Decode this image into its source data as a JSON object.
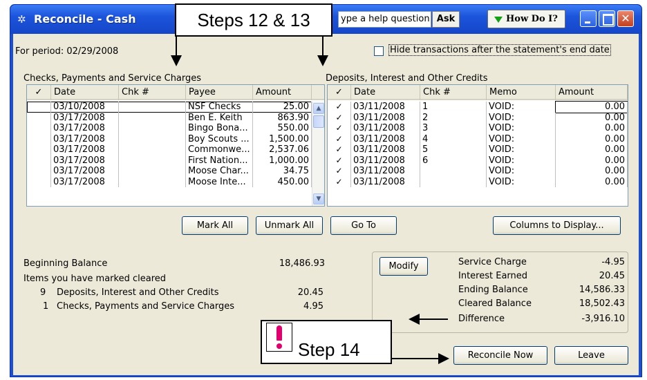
{
  "window": {
    "title": "Reconcile - Cash",
    "help_placeholder": "ype a help question",
    "ask_label": "Ask",
    "howdo_label": "How Do I?"
  },
  "period_label": "For period: 02/29/2008",
  "hide_label": "Hide transactions after the statement's end date",
  "checks": {
    "section_label": "Checks, Payments and Service Charges",
    "headers": [
      "✓",
      "Date",
      "Chk #",
      "Payee",
      "Amount"
    ],
    "rows": [
      {
        "check": "",
        "date": "03/10/2008",
        "chk": "",
        "payee": "NSF Checks",
        "amount": "25.00"
      },
      {
        "check": "",
        "date": "03/17/2008",
        "chk": "",
        "payee": "Ben E. Keith",
        "amount": "863.90"
      },
      {
        "check": "",
        "date": "03/17/2008",
        "chk": "",
        "payee": "Bingo Bona...",
        "amount": "550.00"
      },
      {
        "check": "",
        "date": "03/17/2008",
        "chk": "",
        "payee": "Boy Scouts ...",
        "amount": "1,500.00"
      },
      {
        "check": "",
        "date": "03/17/2008",
        "chk": "",
        "payee": "Commonwe...",
        "amount": "2,537.06"
      },
      {
        "check": "",
        "date": "03/17/2008",
        "chk": "",
        "payee": "First Nation...",
        "amount": "1,000.00"
      },
      {
        "check": "",
        "date": "03/17/2008",
        "chk": "",
        "payee": "Moose Char...",
        "amount": "34.75"
      },
      {
        "check": "",
        "date": "03/17/2008",
        "chk": "",
        "payee": "Moose Inte...",
        "amount": "450.00"
      }
    ]
  },
  "deposits": {
    "section_label": "Deposits, Interest and Other Credits",
    "headers": [
      "✓",
      "Date",
      "Chk #",
      "Memo",
      "Amount"
    ],
    "rows": [
      {
        "check": "✓",
        "date": "03/11/2008",
        "chk": "1",
        "memo": "VOID:",
        "amount": "0.00"
      },
      {
        "check": "✓",
        "date": "03/11/2008",
        "chk": "2",
        "memo": "VOID:",
        "amount": "0.00"
      },
      {
        "check": "✓",
        "date": "03/11/2008",
        "chk": "3",
        "memo": "VOID:",
        "amount": "0.00"
      },
      {
        "check": "✓",
        "date": "03/11/2008",
        "chk": "4",
        "memo": "VOID:",
        "amount": "0.00"
      },
      {
        "check": "✓",
        "date": "03/11/2008",
        "chk": "5",
        "memo": "VOID:",
        "amount": "0.00"
      },
      {
        "check": "✓",
        "date": "03/11/2008",
        "chk": "6",
        "memo": "VOID:",
        "amount": "0.00"
      },
      {
        "check": "✓",
        "date": "03/11/2008",
        "chk": "",
        "memo": "VOID:",
        "amount": "0.00"
      },
      {
        "check": "✓",
        "date": "03/11/2008",
        "chk": "",
        "memo": "VOID:",
        "amount": "0.00"
      }
    ]
  },
  "buttons": {
    "mark_all": "Mark All",
    "unmark_all": "Unmark All",
    "go_to": "Go To",
    "columns_to_display": "Columns to Display...",
    "modify": "Modify",
    "reconcile_now": "Reconcile Now",
    "leave": "Leave"
  },
  "summary": {
    "beginning_balance_label": "Beginning Balance",
    "beginning_balance_value": "18,486.93",
    "items_cleared_label": "Items you have marked cleared",
    "deposits_count": "9",
    "deposits_label": "Deposits, Interest and Other Credits",
    "deposits_value": "20.45",
    "checks_count": "1",
    "checks_label": "Checks, Payments and Service Charges",
    "checks_value": "4.95"
  },
  "balances": [
    {
      "label": "Service Charge",
      "value": "-4.95"
    },
    {
      "label": "Interest Earned",
      "value": "20.45"
    },
    {
      "label": "Ending Balance",
      "value": "14,586.33"
    },
    {
      "label": "Cleared Balance",
      "value": "18,502.43"
    },
    {
      "label": "Difference",
      "value": "-3,916.10"
    }
  ],
  "callouts": {
    "steps_12_13": "Steps 12 & 13",
    "step_14": "Step 14"
  }
}
